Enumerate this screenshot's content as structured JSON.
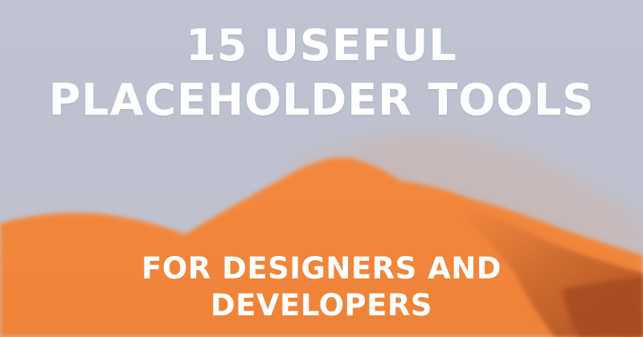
{
  "banner": {
    "title_line_1": "15 USEFUL",
    "title_line_2": "PLACEHOLDER TOOLS",
    "subtitle_line_1": "FOR DESIGNERS AND",
    "subtitle_line_2": "DEVELOPERS"
  },
  "colors": {
    "sky": "#bec2d0",
    "dune": "#f28a42",
    "dune_shadow": "#b8592a",
    "text": "#ffffff"
  }
}
